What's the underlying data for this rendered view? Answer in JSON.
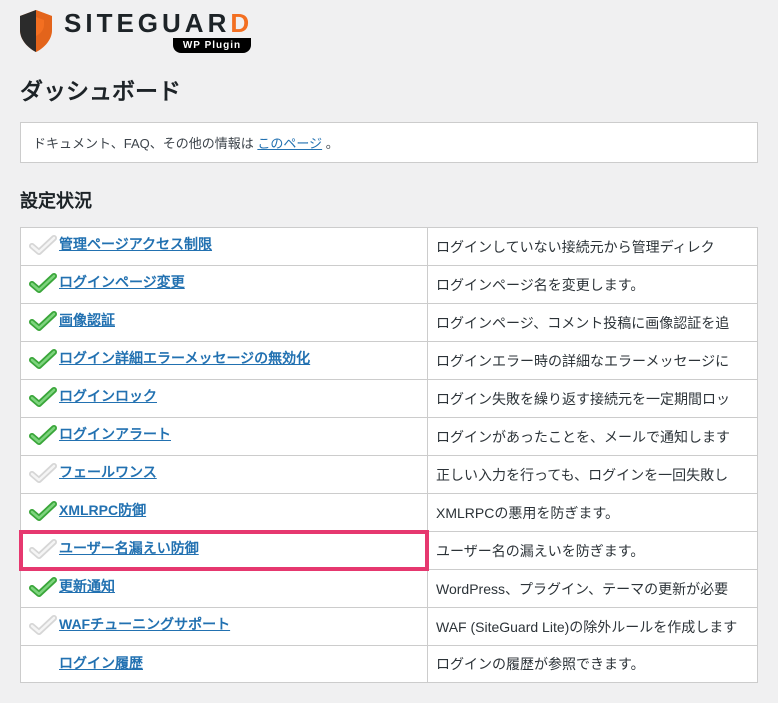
{
  "brand": {
    "name_prefix": "SITEGUAR",
    "name_suffix": "D",
    "badge": "WP Plugin"
  },
  "page_title": "ダッシュボード",
  "notice": {
    "before": "ドキュメント、FAQ、その他の情報は ",
    "link_text": "このページ",
    "after": " 。"
  },
  "section_title": "設定状況",
  "rows": [
    {
      "name": "管理ページアクセス制限",
      "desc": "ログインしていない接続元から管理ディレク",
      "enabled": false
    },
    {
      "name": "ログインページ変更",
      "desc": "ログインページ名を変更します。",
      "enabled": true
    },
    {
      "name": "画像認証",
      "desc": "ログインページ、コメント投稿に画像認証を追",
      "enabled": true
    },
    {
      "name": "ログイン詳細エラーメッセージの無効化",
      "desc": "ログインエラー時の詳細なエラーメッセージに",
      "enabled": true
    },
    {
      "name": "ログインロック",
      "desc": "ログイン失敗を繰り返す接続元を一定期間ロッ",
      "enabled": true
    },
    {
      "name": "ログインアラート",
      "desc": "ログインがあったことを、メールで通知します",
      "enabled": true
    },
    {
      "name": "フェールワンス",
      "desc": "正しい入力を行っても、ログインを一回失敗し",
      "enabled": false
    },
    {
      "name": "XMLRPC防御",
      "desc": "XMLRPCの悪用を防ぎます。",
      "enabled": true
    },
    {
      "name": "ユーザー名漏えい防御",
      "desc": "ユーザー名の漏えいを防ぎます。",
      "enabled": false,
      "highlight": true
    },
    {
      "name": "更新通知",
      "desc": "WordPress、プラグイン、テーマの更新が必要",
      "enabled": true
    },
    {
      "name": "WAFチューニングサポート",
      "desc": "WAF (SiteGuard Lite)の除外ルールを作成します",
      "enabled": false
    },
    {
      "name": "ログイン履歴",
      "desc": "ログインの履歴が参照できます。",
      "enabled": null
    }
  ]
}
